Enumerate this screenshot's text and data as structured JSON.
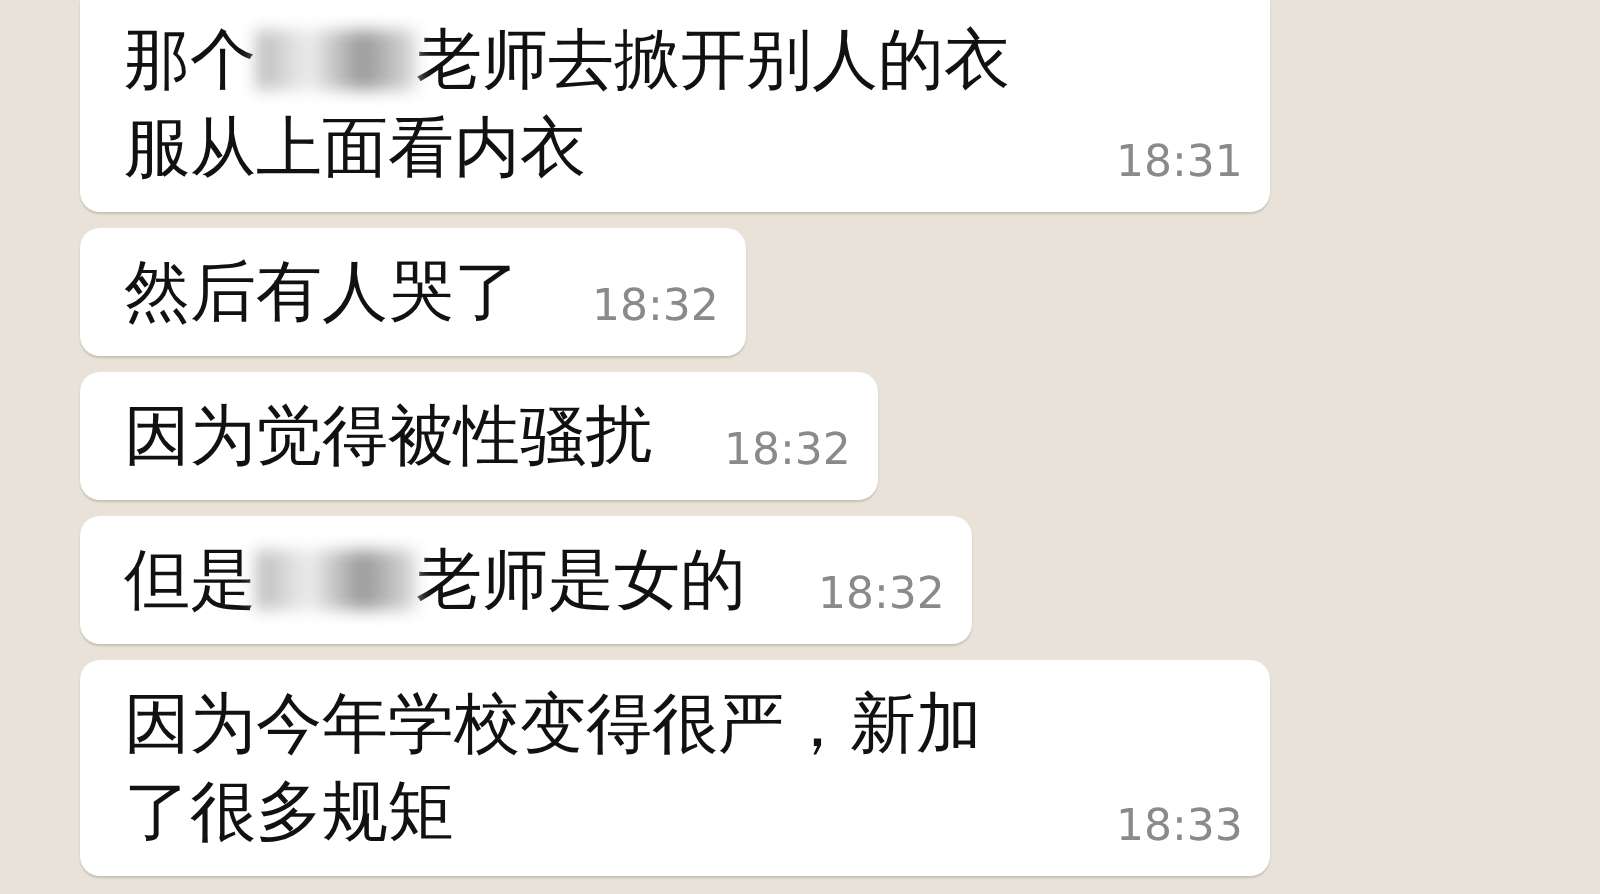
{
  "messages": [
    {
      "parts": [
        {
          "kind": "text",
          "text": "那个"
        },
        {
          "kind": "redacted"
        },
        {
          "kind": "text",
          "text": "老师去掀开别人的衣服从上面看内衣"
        }
      ],
      "time": "18:31"
    },
    {
      "parts": [
        {
          "kind": "text",
          "text": "然后有人哭了"
        }
      ],
      "time": "18:32"
    },
    {
      "parts": [
        {
          "kind": "text",
          "text": "因为觉得被性骚扰"
        }
      ],
      "time": "18:32"
    },
    {
      "parts": [
        {
          "kind": "text",
          "text": "但是"
        },
        {
          "kind": "redacted"
        },
        {
          "kind": "text",
          "text": "老师是女的"
        }
      ],
      "time": "18:32"
    },
    {
      "parts": [
        {
          "kind": "text",
          "text": "因为今年学校变得很严，新加了很多规矩"
        }
      ],
      "time": "18:33"
    }
  ]
}
